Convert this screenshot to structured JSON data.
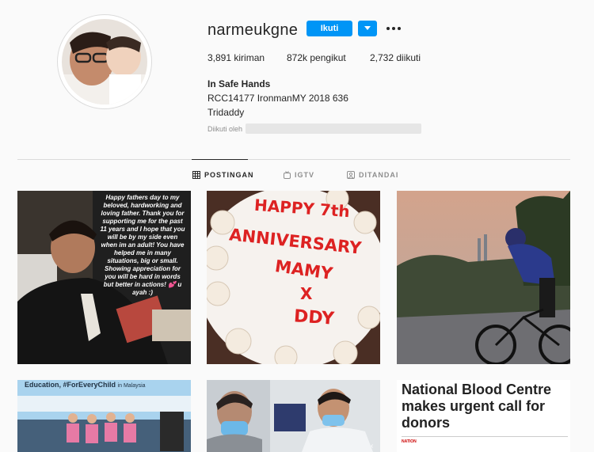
{
  "profile": {
    "username": "narmeukgne",
    "follow_label": "Ikuti",
    "stats": {
      "posts": "3,891",
      "posts_label": "kiriman",
      "followers": "872k",
      "followers_label": "pengikut",
      "following": "2,732",
      "following_label": "diikuti"
    },
    "bio": {
      "name": "In Safe Hands",
      "line1": "RCC14177 IronmanMY 2018 636",
      "line2": "Tridaddy"
    },
    "followed_by_label": "Diikuti oleh"
  },
  "tabs": [
    {
      "label": "POSTINGAN",
      "icon": "grid-icon",
      "active": true
    },
    {
      "label": "IGTV",
      "icon": "igtv-icon",
      "active": false
    },
    {
      "label": "DITANDAI",
      "icon": "tagged-icon",
      "active": false
    }
  ],
  "posts": {
    "p1_caption": "Happy fathers day to my beloved, hardworking and loving father. Thank you for supporting me for the past 11 years and I hope that you will be by my side even when im an adult! You have helped me in many situations, big or small. Showing appreciation for you will be hard in words but better in actions! 💕 u ayah :)",
    "p2_line1": "HAPPY 7th",
    "p2_line2": "ANNIVERSARY",
    "p2_line3": "MAMY",
    "p2_line4": "X",
    "p2_line5": "DDY",
    "p4_caption_main": "Education, #ForEveryChild",
    "p4_caption_sub": "in Malaysia",
    "p6_headline": "National Blood Centre makes urgent call for donors",
    "p6_source": "NATION"
  },
  "colors": {
    "accent": "#0095f6",
    "text": "#262626",
    "muted": "#8e8e8e",
    "border": "#dbdbdb",
    "background": "#fafafa"
  }
}
